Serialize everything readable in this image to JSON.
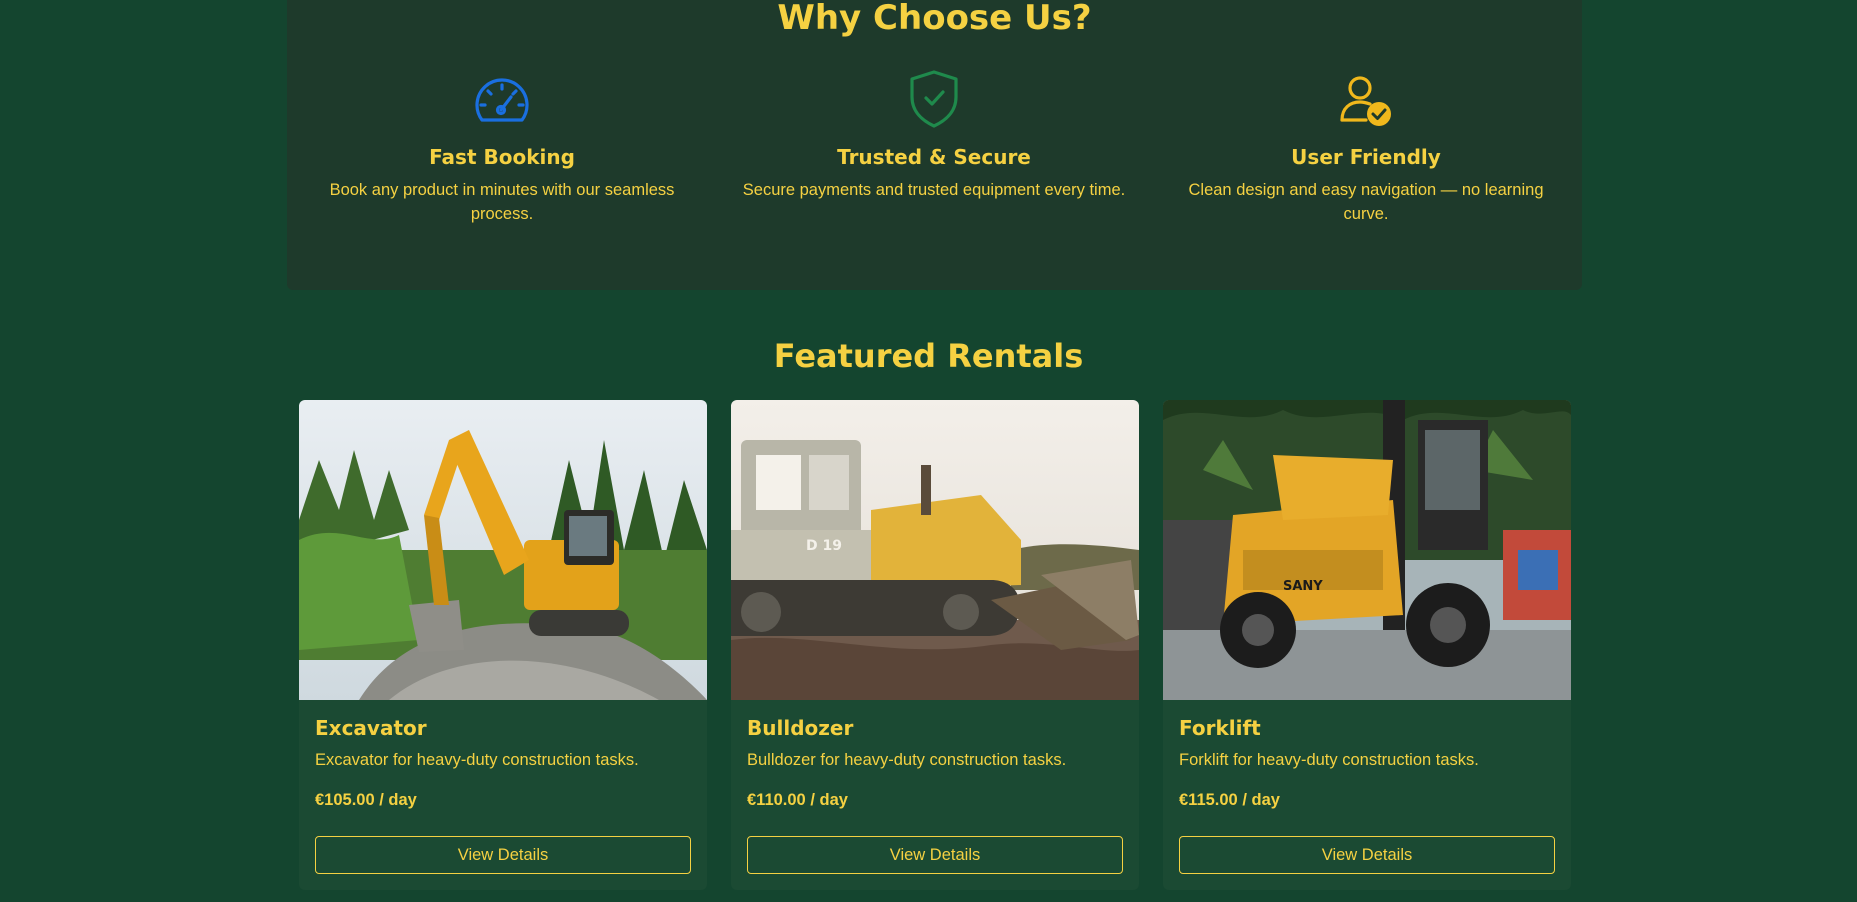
{
  "why": {
    "title": "Why Choose Us?",
    "features": [
      {
        "icon": "speedometer-icon",
        "title": "Fast Booking",
        "text": "Book any product in minutes with our seamless process."
      },
      {
        "icon": "shield-check-icon",
        "title": "Trusted & Secure",
        "text": "Secure payments and trusted equipment every time."
      },
      {
        "icon": "user-check-icon",
        "title": "User Friendly",
        "text": "Clean design and easy navigation — no learning curve."
      }
    ]
  },
  "featured": {
    "title": "Featured Rentals",
    "items": [
      {
        "name": "Excavator",
        "description": "Excavator for heavy-duty construction tasks.",
        "price": "€105.00 / day",
        "button": "View Details"
      },
      {
        "name": "Bulldozer",
        "description": "Bulldozer for heavy-duty construction tasks.",
        "price": "€110.00 / day",
        "button": "View Details"
      },
      {
        "name": "Forklift",
        "description": "Forklift for heavy-duty construction tasks.",
        "price": "€115.00 / day",
        "button": "View Details"
      }
    ]
  },
  "colors": {
    "page_background": "#14452f",
    "panel_background": "#1e3a2b",
    "card_background": "#1b4a33",
    "accent_yellow": "#f5d142",
    "icon_blue": "#1a6fe0",
    "icon_green": "#1f8a4c",
    "icon_gold": "#f0b81c"
  }
}
